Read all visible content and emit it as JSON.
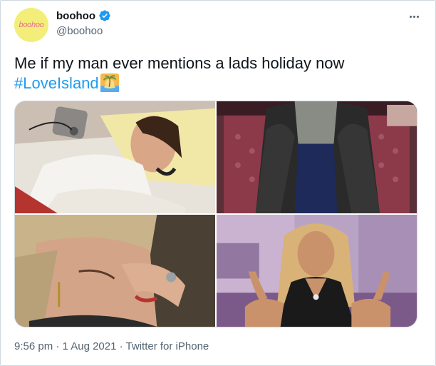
{
  "author": {
    "display_name": "boohoo",
    "handle": "@boohoo",
    "avatar_text": "boohoo",
    "verified_icon": "verified-badge-icon"
  },
  "tweet": {
    "text": "Me if my man ever mentions a lads holiday now",
    "hashtag": "#LoveIsland",
    "emoji_icon": "island-emoji-icon"
  },
  "media": [
    {
      "name": "photo-crying-in-bed"
    },
    {
      "name": "photo-covering-face-on-throne"
    },
    {
      "name": "photo-crying-blonde-woman"
    },
    {
      "name": "photo-tv-host-crying"
    }
  ],
  "meta": {
    "time": "9:56 pm",
    "separator": "·",
    "date": "1 Aug 2021",
    "source": "Twitter for iPhone"
  },
  "colors": {
    "link": "#1d9bf0",
    "text": "#0f1419",
    "muted": "#536471",
    "avatar_bg": "#f3ee7a",
    "avatar_text": "#e56f8b"
  }
}
